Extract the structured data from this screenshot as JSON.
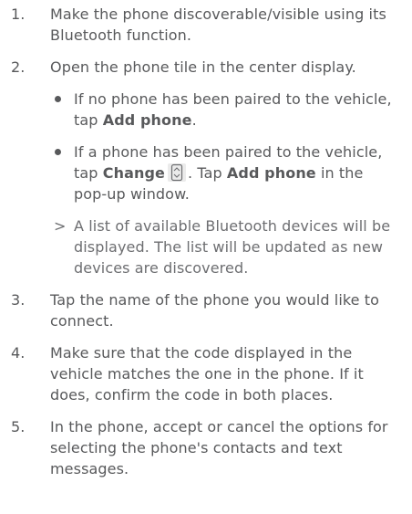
{
  "steps": [
    {
      "num": "1.",
      "text": "Make the phone discoverable/visible using its Bluetooth function."
    },
    {
      "num": "2.",
      "text": "Open the phone tile in the center display.",
      "sub": [
        {
          "marker": "bullet",
          "pre": "If no phone has been paired to the vehi­cle, tap ",
          "bold": "Add phone",
          "post": "."
        },
        {
          "marker": "bullet",
          "pre": "If a phone has been paired to the vehi­cle, tap ",
          "bold": "Change",
          "icon": "change-icon",
          "mid": ". Tap ",
          "bold2": "Add phone",
          "post": " in the pop-up window."
        },
        {
          "marker": ">",
          "text": "A list of available Bluetooth devices will be displayed. The list will be updated as new devices are discovered."
        }
      ]
    },
    {
      "num": "3.",
      "text": "Tap the name of the phone you would like to connect."
    },
    {
      "num": "4.",
      "text": "Make sure that the code displayed in the vehicle matches the one in the phone. If it does, confirm the code in both places."
    },
    {
      "num": "5.",
      "text": "In the phone, accept or cancel the options for selecting the phone's contacts and text messages."
    }
  ]
}
